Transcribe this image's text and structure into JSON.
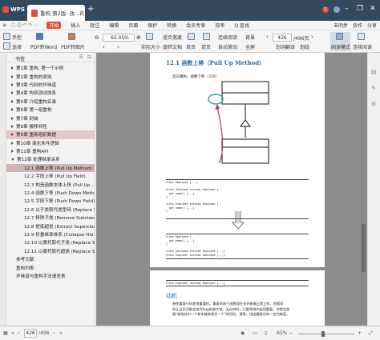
{
  "titlebar": {
    "app": "WPS",
    "tab_title": "重构 第2版: 改…的设计_.pdf",
    "new_tab": "+",
    "badge": "1"
  },
  "menu": [
    "开始",
    "插入",
    "批注",
    "编辑",
    "页面",
    "保护",
    "转换",
    "会员专享",
    "效率",
    "Q 查找"
  ],
  "menu_right": [
    "未同步",
    "协作",
    "分享"
  ],
  "toolbar": {
    "hand": "手型",
    "select": "选择",
    "pdf_to_word": "PDF转Word",
    "pdf_to_image": "PDF转图片",
    "zoom": "65.05%",
    "actual_size": "实际大小",
    "fit_width": "适合宽度",
    "rotate": "旋转文档",
    "single_page": "单页",
    "double_page": "双页",
    "continuous": "连续阅读",
    "auto_scroll": "自动滚动",
    "background": "背景",
    "full_screen": "全屏",
    "translate": "划词翻译",
    "highlight": "划线",
    "page_current": "426",
    "page_total": "/496页",
    "read_mode": "阅读模式",
    "night_mode": "连续阅读"
  },
  "sidebar": {
    "title": "书签",
    "items": [
      {
        "label": "第1章 重构, 第一个示例",
        "level": 0,
        "state": "collapsed"
      },
      {
        "label": "第2章 重构的原则",
        "level": 0,
        "state": "collapsed"
      },
      {
        "label": "第3章 代码的坏味道",
        "level": 0,
        "state": "collapsed"
      },
      {
        "label": "第4章 构筑测试体系",
        "level": 0,
        "state": "collapsed"
      },
      {
        "label": "第5章 介绍重构名录",
        "level": 0,
        "state": "collapsed"
      },
      {
        "label": "第6章 第一组重构",
        "level": 0,
        "state": "collapsed"
      },
      {
        "label": "第7章 封装",
        "level": 0,
        "state": "collapsed"
      },
      {
        "label": "第8章 搬移特性",
        "level": 0,
        "state": "collapsed"
      },
      {
        "label": "第9章 重新组织数据",
        "level": 0,
        "state": "collapsed",
        "highlight": true
      },
      {
        "label": "第10章 简化条件逻辑",
        "level": 0,
        "state": "collapsed"
      },
      {
        "label": "第11章 重构API",
        "level": 0,
        "state": "collapsed"
      },
      {
        "label": "第12章 处理继承关系",
        "level": 0,
        "state": "expanded"
      },
      {
        "label": "12.1 函数上移 (Pull Up Method)",
        "level": 1,
        "selected": true
      },
      {
        "label": "12.2 字段上移 (Pull Up Field)",
        "level": 1
      },
      {
        "label": "12.3 构造函数本体上移 (Pull Up …",
        "level": 1
      },
      {
        "label": "12.4 函数下移 (Push Down Meth…",
        "level": 1
      },
      {
        "label": "12.5 字段下移 (Push Down Field)",
        "level": 1
      },
      {
        "label": "12.6 以子类取代类型码 (Replace S…",
        "level": 1
      },
      {
        "label": "12.7 移除子类 (Remove Subclass…",
        "level": 1
      },
      {
        "label": "12.8 提炼超类 (Extract Superclas…",
        "level": 1
      },
      {
        "label": "12.9 折叠继承体系 (Collapse Hie…",
        "level": 1
      },
      {
        "label": "12.10 以委托取代子类 (Replace S…",
        "level": 1
      },
      {
        "label": "12.11 以委托取代超类 (Replace S…",
        "level": 1
      },
      {
        "label": "参考文献",
        "level": 0
      },
      {
        "label": "重构列表",
        "level": 0
      },
      {
        "label": "坏味道与重构手法速查表",
        "level": 0
      }
    ]
  },
  "document": {
    "heading": "12.1  函数上移（Pull Up Method）",
    "reverse": "反向重构：函数下移（330）",
    "code1": [
      "class Employee {...}",
      "",
      "class Salesman extends Employee {",
      "  get name() {...}",
      "}",
      "",
      "class Engineer extends Employee {",
      "  get name() {...}",
      "}"
    ],
    "code2": [
      "class Employee {",
      "  get name() {...}",
      "}",
      "",
      "class Salesman extends Employee {...}",
      "class Engineer extends Employee {...}"
    ],
    "code3": [
      "class Engineer extends Employee {...}"
    ],
    "motivation_title": "动机",
    "motivation_text": [
      "避免重复代码是很重要的。重复的两个函数现在也许能够正常工作，但假如",
      "别让日后可能会成为bug的滋生地。无论何时，只要系统内出现重复，你就会面",
      "临\"修改其中一个却未能修改另一个\"的风险。通常，找出重复也有一定的难度。"
    ]
  },
  "statusbar": {
    "page_current": "426",
    "page_total": "/496",
    "zoom": "65%"
  }
}
